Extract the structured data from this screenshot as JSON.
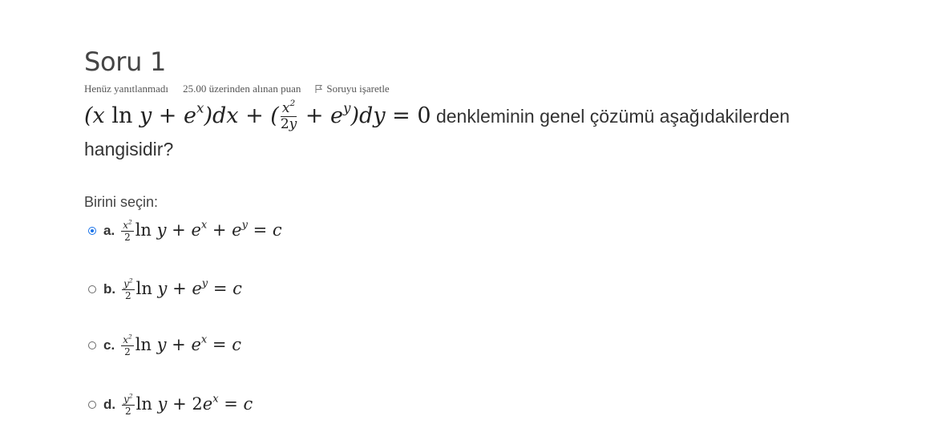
{
  "question": {
    "title": "Soru 1",
    "status": "Henüz yanıtlanmadı",
    "grade": "25.00 üzerinden alınan puan",
    "flag_label": "Soruyu işaretle",
    "stem_text": "denkleminin genel çözümü aşağıdakilerden hangisidir?",
    "prompt": "Birini seçin:"
  },
  "answers": [
    {
      "label": "a.",
      "selected": true
    },
    {
      "label": "b.",
      "selected": false
    },
    {
      "label": "c.",
      "selected": false
    },
    {
      "label": "d.",
      "selected": false
    }
  ],
  "colors": {
    "accent": "#1a73e8",
    "text": "#333333"
  },
  "icons": {
    "flag": "flag-icon"
  }
}
